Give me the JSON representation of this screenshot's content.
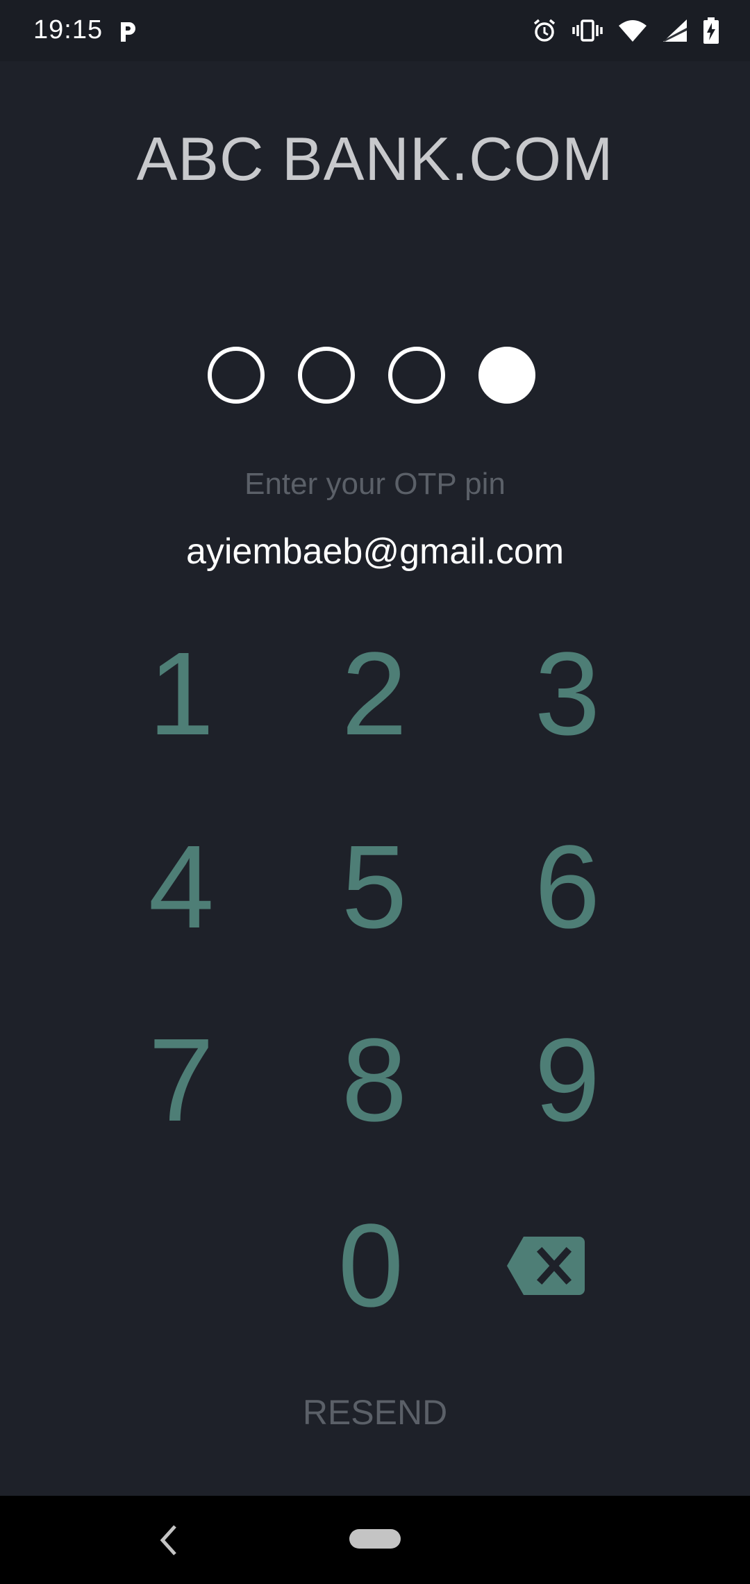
{
  "status_bar": {
    "time": "19:15",
    "icons": [
      "parking-icon",
      "alarm-icon",
      "vibrate-icon",
      "wifi-icon",
      "signal-icon",
      "battery-charging-icon"
    ]
  },
  "app": {
    "title": "ABC BANK.COM"
  },
  "pin": {
    "length": 4,
    "filled": [
      false,
      false,
      false,
      true
    ]
  },
  "prompt": "Enter your OTP pin",
  "email": "ayiembaeb@gmail.com",
  "keypad": {
    "keys": [
      "1",
      "2",
      "3",
      "4",
      "5",
      "6",
      "7",
      "8",
      "9",
      "0"
    ],
    "backspace_icon": "backspace-icon"
  },
  "resend_label": "RESEND",
  "colors": {
    "background": "#1e2129",
    "key_digit": "#4e7e76",
    "muted_text": "#5b6068",
    "title_text": "#c8c9cc"
  },
  "nav_bar": {
    "icons": [
      "back-icon",
      "home-pill-icon"
    ]
  }
}
